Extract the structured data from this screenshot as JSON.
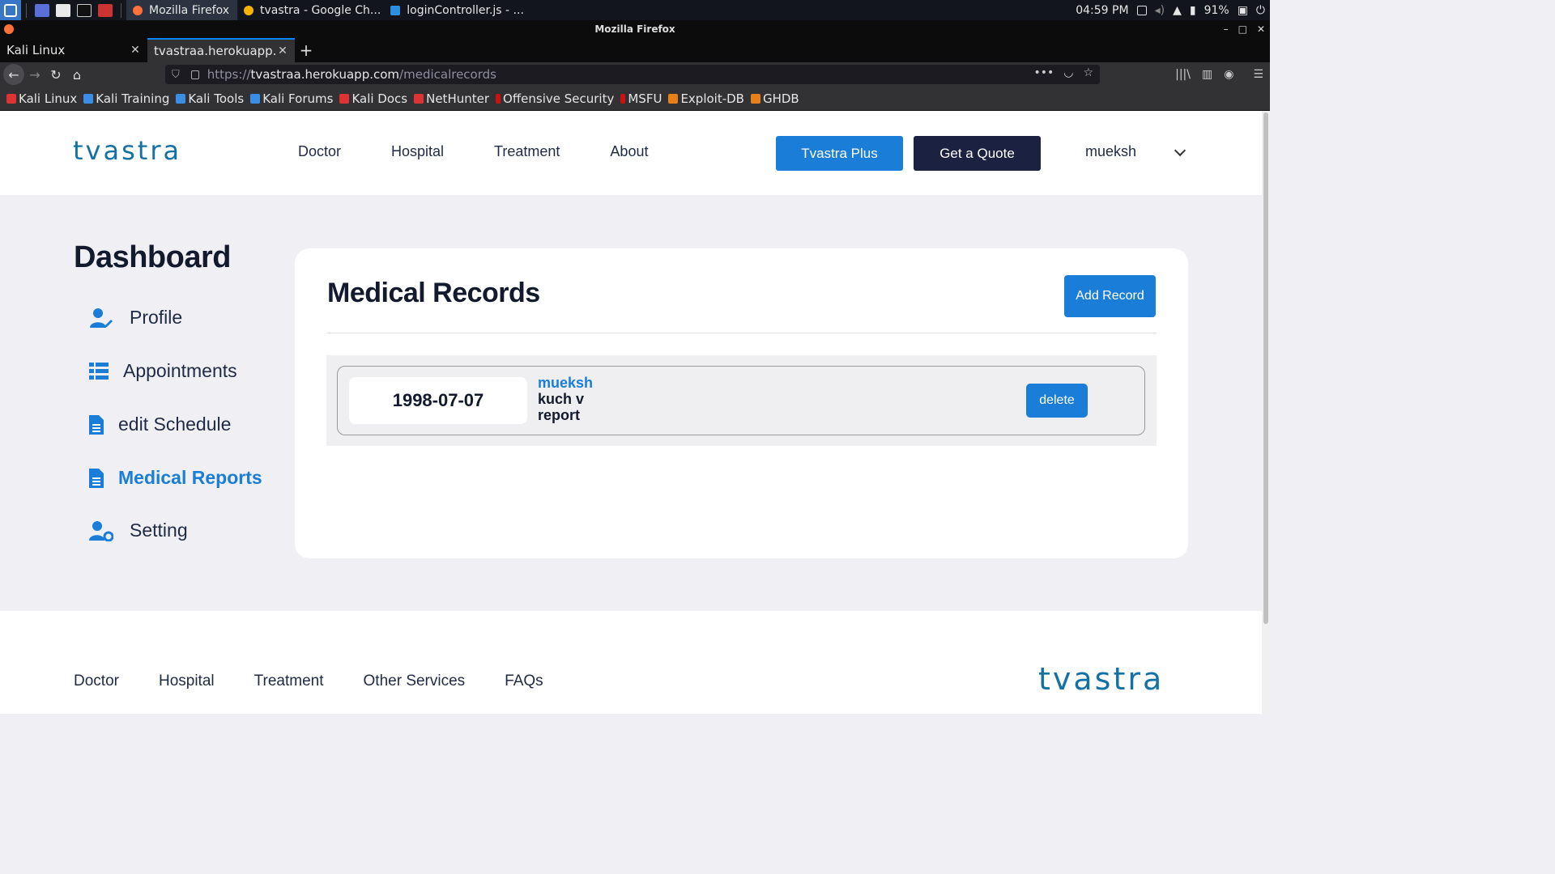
{
  "taskbar": {
    "tasks": [
      "Mozilla Firefox",
      "tvastra - Google Ch...",
      "loginController.js - ..."
    ],
    "clock": "04:59 PM",
    "battery": "91%"
  },
  "window": {
    "title": "Mozilla Firefox"
  },
  "tabs": [
    {
      "label": "Kali Linux"
    },
    {
      "label": "tvastraa.herokuapp.com"
    }
  ],
  "urlbar": {
    "protocol": "https://",
    "host": "tvastraa.herokuapp.com",
    "path": "/medicalrecords"
  },
  "bookmarks": [
    "Kali Linux",
    "Kali Training",
    "Kali Tools",
    "Kali Forums",
    "Kali Docs",
    "NetHunter",
    "Offensive Security",
    "MSFU",
    "Exploit-DB",
    "GHDB"
  ],
  "site": {
    "logo_text": "tvastra",
    "nav": [
      "Doctor",
      "Hospital",
      "Treatment",
      "About"
    ],
    "plus_button": "Tvastra Plus",
    "quote_button": "Get a Quote",
    "username": "mueksh"
  },
  "sidebar": {
    "title": "Dashboard",
    "items": [
      {
        "label": "Profile"
      },
      {
        "label": "Appointments"
      },
      {
        "label": "edit Schedule"
      },
      {
        "label": "Medical Reports"
      },
      {
        "label": "Setting"
      }
    ]
  },
  "records": {
    "title": "Medical Records",
    "add_button": "Add Record",
    "items": [
      {
        "date": "1998-07-07",
        "user": "mueksh",
        "description": "kuch v report",
        "delete_label": "delete"
      }
    ]
  },
  "footer": {
    "nav": [
      "Doctor",
      "Hospital",
      "Treatment",
      "Other Services",
      "FAQs"
    ]
  },
  "colors": {
    "accent": "#1a7ed9",
    "navy": "#1b2140",
    "logo": "#1471a6"
  }
}
